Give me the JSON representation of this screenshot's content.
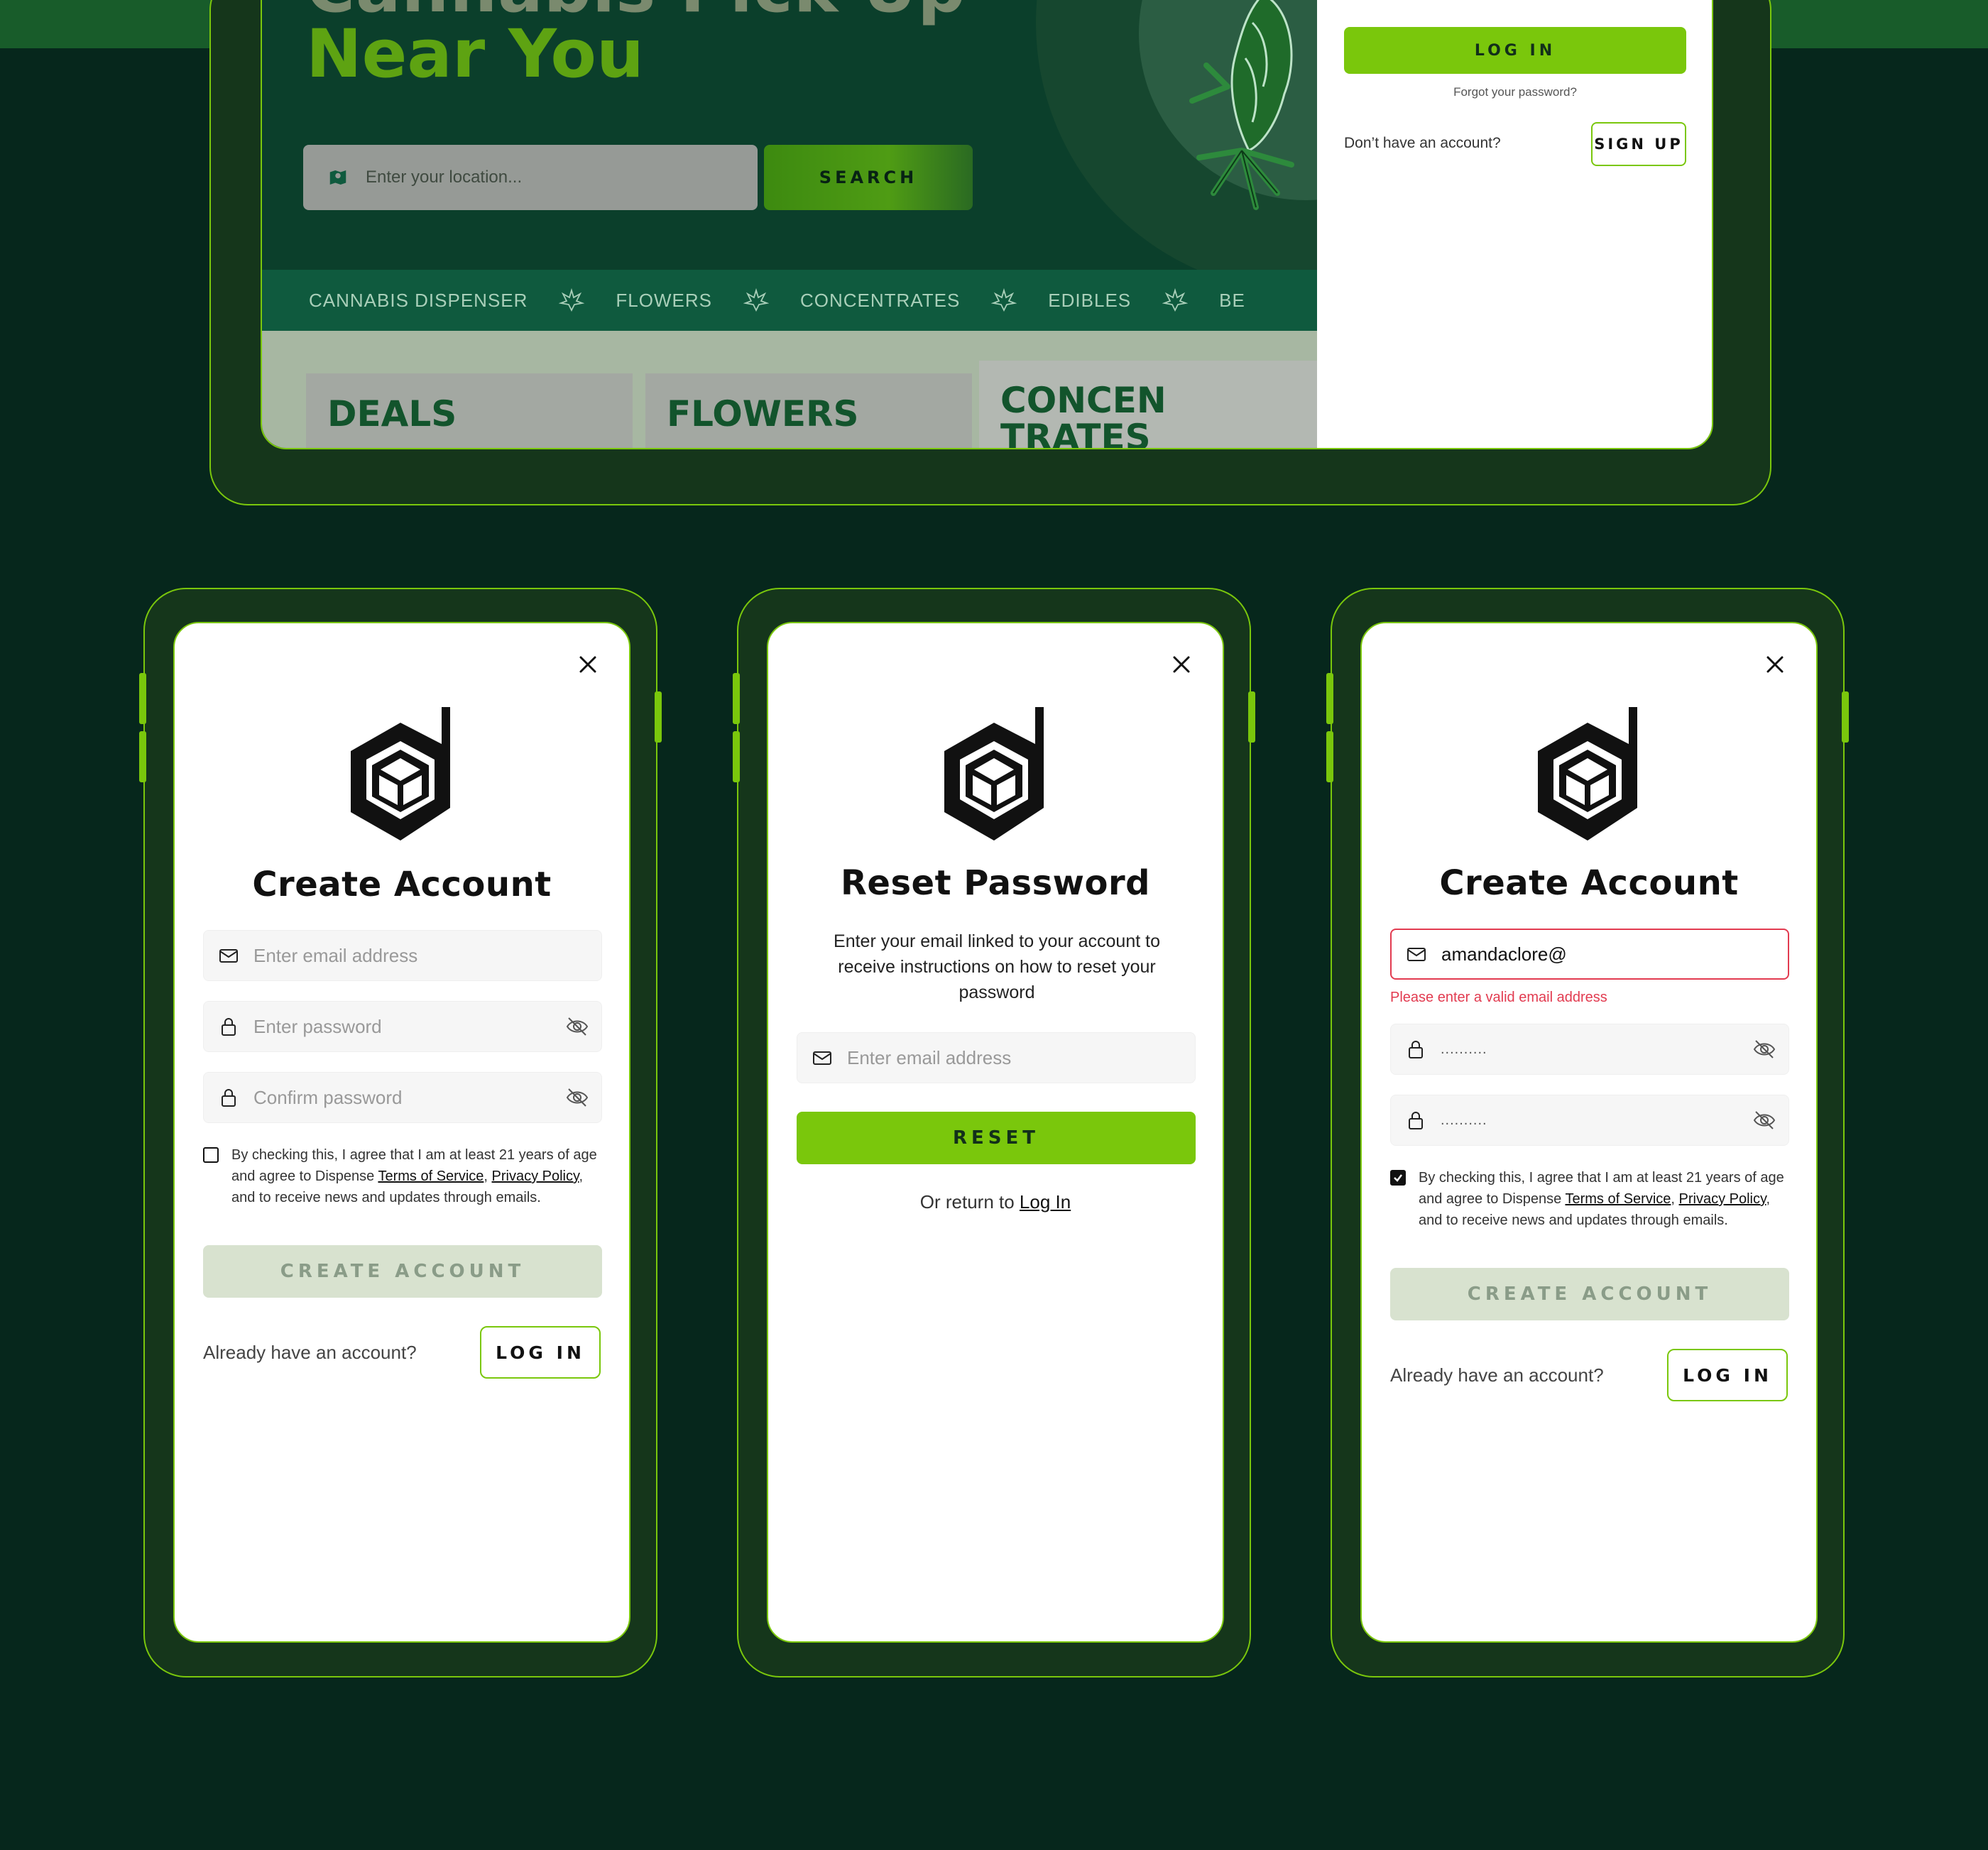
{
  "hero": {
    "title_line1": "Cannabis Pick Up",
    "title_line2": "Near You",
    "location_placeholder": "Enter your location...",
    "search_label": "SEARCH"
  },
  "nav": {
    "items": [
      "CANNABIS DISPENSER",
      "FLOWERS",
      "CONCENTRATES",
      "EDIBLES",
      "BE"
    ]
  },
  "categories": {
    "cards": [
      "DEALS",
      "FLOWERS",
      "CONCEN\nTRATES"
    ]
  },
  "login_panel": {
    "login_label": "LOG IN",
    "forgot_label": "Forgot your password?",
    "no_account_text": "Don’t have an account?",
    "signup_label": "SIGN UP"
  },
  "create_account": {
    "title": "Create Account",
    "email_placeholder": "Enter email address",
    "password_placeholder": "Enter password",
    "confirm_placeholder": "Confirm password",
    "agree_prefix": "By checking this, I agree that I am at least 21 years of age and agree to Dispense ",
    "terms_label": "Terms of Service",
    "comma": ", ",
    "privacy_label": "Privacy Policy",
    "agree_suffix": ", and to receive news and updates through emails.",
    "create_label": "CREATE ACCOUNT",
    "already_text": "Already have an account?",
    "login_label": "LOG IN"
  },
  "reset_password": {
    "title": "Reset Password",
    "description": "Enter your email linked to your account to receive instructions on how to reset your password",
    "email_placeholder": "Enter email address",
    "reset_label": "RESET",
    "return_text": "Or return to ",
    "return_link": "Log In"
  },
  "create_account_error": {
    "title": "Create Account",
    "email_value": "amandaclore@",
    "error_text": "Please enter a valid email address",
    "password_mask": "..........",
    "confirm_mask": "..........",
    "agree_prefix": "By checking this, I agree that I am at least 21 years of age and agree to Dispense ",
    "terms_label": "Terms of Service",
    "comma": ", ",
    "privacy_label": "Privacy Policy",
    "agree_suffix": ", and to receive news and updates through emails.",
    "create_label": "CREATE ACCOUNT",
    "already_text": "Already have an account?",
    "login_label": "LOG IN"
  },
  "colors": {
    "background": "#06271c",
    "accent_green": "#7ac70c",
    "error_red": "#e23b50",
    "disabled_button": "#d8e2cf"
  },
  "icons": [
    "map-pin-icon",
    "cannabis-leaf-icon",
    "close-icon",
    "dispense-logo-icon",
    "mail-icon",
    "lock-icon",
    "eye-off-icon",
    "checkbox-checked-icon"
  ]
}
